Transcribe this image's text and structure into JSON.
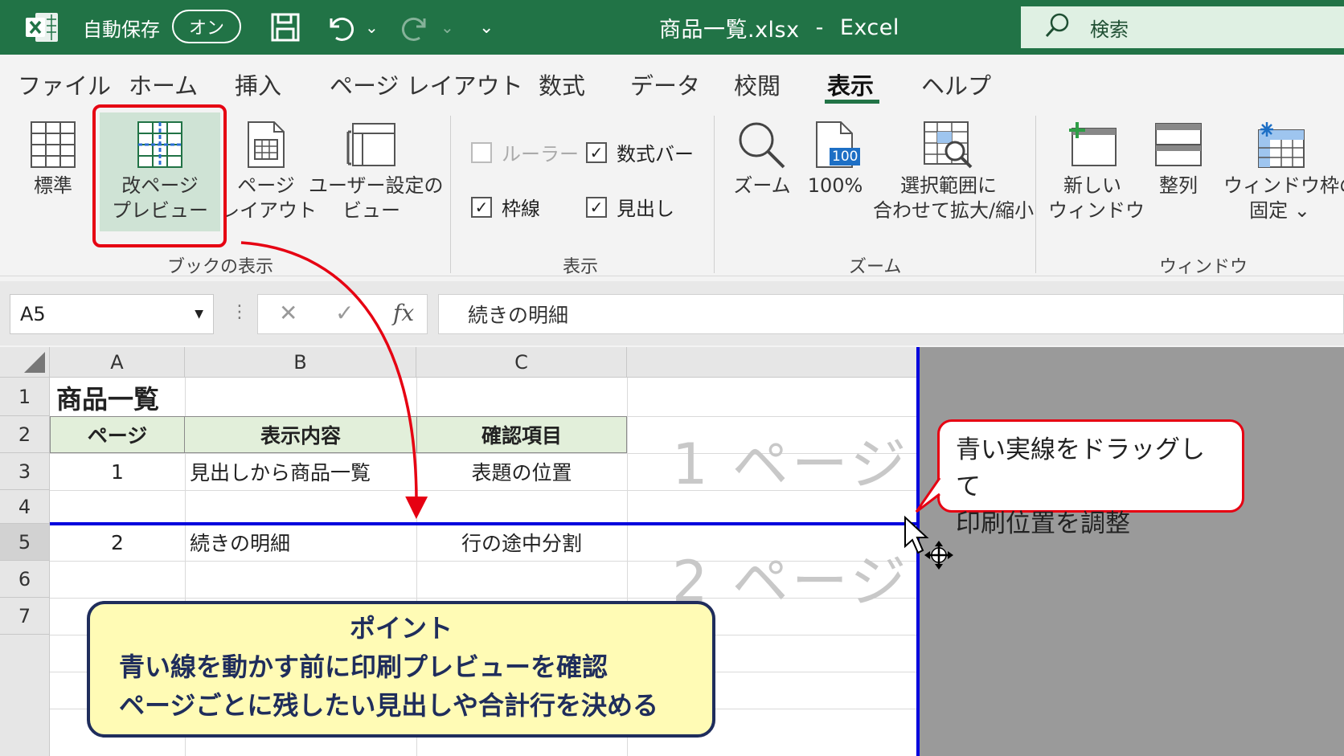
{
  "titlebar": {
    "autosave_label": "自動保存",
    "autosave_state": "オン",
    "file_name": "商品一覧.xlsx",
    "separator": "-",
    "app_name": "Excel",
    "search_label": "検索"
  },
  "tabs": [
    {
      "label": "ファイル"
    },
    {
      "label": "ホーム"
    },
    {
      "label": "挿入"
    },
    {
      "label": "ページ レイアウト"
    },
    {
      "label": "数式"
    },
    {
      "label": "データ"
    },
    {
      "label": "校閲"
    },
    {
      "label": "表示"
    },
    {
      "label": "ヘルプ"
    }
  ],
  "active_tab": "表示",
  "ribbon": {
    "book_view": {
      "label": "ブックの表示",
      "normal": "標準",
      "page_break_1": "改ページ",
      "page_break_2": "プレビュー",
      "page_layout_1": "ページ",
      "page_layout_2": "レイアウト",
      "custom_view_1": "ユーザー設定の",
      "custom_view_2": "ビュー"
    },
    "show": {
      "label": "表示",
      "ruler": "ルーラー",
      "formula_bar": "数式バー",
      "gridlines": "枠線",
      "headings": "見出し",
      "ruler_checked": false,
      "formula_bar_checked": true,
      "gridlines_checked": true,
      "headings_checked": true,
      "check_mark": "✓"
    },
    "zoom": {
      "label": "ズーム",
      "zoom": "ズーム",
      "hundred": "100%",
      "hundred_badge": "100",
      "fit_1": "選択範囲に",
      "fit_2": "合わせて拡大/縮小"
    },
    "window": {
      "label": "ウィンドウ",
      "new_1": "新しい",
      "new_2": "ウィンドウ",
      "arrange": "整列",
      "freeze_1": "ウィンドウ枠の",
      "freeze_2": "固定 ⌄"
    }
  },
  "formula_bar": {
    "name_box": "A5",
    "cancel": "✕",
    "enter": "✓",
    "fx": "fx",
    "content": "続きの明細"
  },
  "sheet": {
    "columns": [
      "A",
      "B",
      "C"
    ],
    "rows": [
      "1",
      "2",
      "3",
      "4",
      "5",
      "6",
      "7"
    ],
    "title": "商品一覧",
    "headers": [
      "ページ",
      "表示内容",
      "確認項目"
    ],
    "row3": [
      "1",
      "見出しから商品一覧",
      "表題の位置"
    ],
    "row5": [
      "2",
      "続きの明細",
      "行の途中分割"
    ],
    "page1": "1 ページ",
    "page2": "2 ページ"
  },
  "callouts": {
    "drag_1": "青い実線をドラッグして",
    "drag_2": "印刷位置を調整",
    "point_title": "ポイント",
    "point_1": "青い線を動かす前に印刷プレビューを確認",
    "point_2": "ページごとに残したい見出しや合計行を決める"
  },
  "colors": {
    "excel_green": "#217346",
    "page_break_blue": "#0000dd",
    "highlight_red": "#e60012",
    "point_bg": "#fffbb5",
    "point_border": "#1f2d5c"
  }
}
